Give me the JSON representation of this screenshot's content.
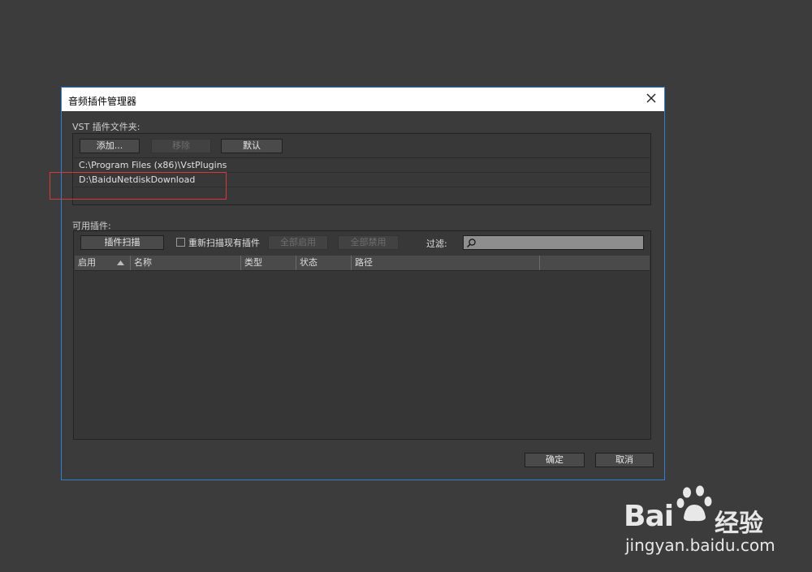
{
  "dialog": {
    "title": "音频插件管理器",
    "close_icon": "close-icon"
  },
  "vst_section": {
    "label": "VST 插件文件夹:",
    "buttons": {
      "add": "添加...",
      "remove": "移除",
      "default": "默认"
    },
    "folders": [
      "C:\\Program Files (x86)\\VstPlugins",
      "D:\\BaiduNetdiskDownload"
    ]
  },
  "plugins_section": {
    "label": "可用插件:",
    "scan_button": "插件扫描",
    "rescan_checkbox_label": "重新扫描现有插件",
    "rescan_checked": false,
    "enable_all_button": "全部启用",
    "disable_all_button": "全部禁用",
    "filter_label": "过滤:",
    "filter_value": "",
    "search_icon": "search-icon",
    "columns": [
      "启用",
      "名称",
      "类型",
      "状态",
      "路径"
    ],
    "sort_icon": "sort-ascending-icon"
  },
  "footer": {
    "ok_button": "确定",
    "cancel_button": "取消"
  },
  "watermark": {
    "brand": "Bai",
    "brand_suffix": "经验",
    "url": "jingyan.baidu.com",
    "logo_icon": "paw-icon"
  },
  "colors": {
    "accent_border": "#2f7fd0",
    "highlight": "#d33b3b",
    "background": "#3c3c3c"
  }
}
